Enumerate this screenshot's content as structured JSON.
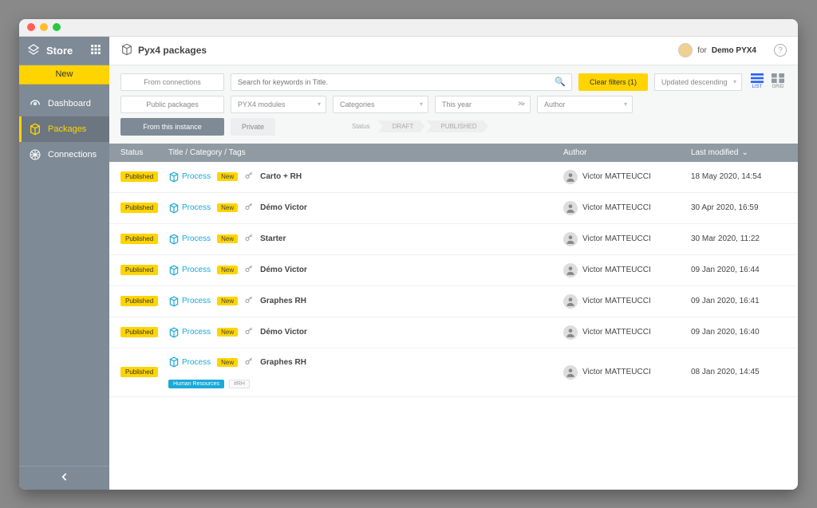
{
  "sidebar": {
    "title": "Store",
    "new_label": "New",
    "items": [
      {
        "label": "Dashboard"
      },
      {
        "label": "Packages"
      },
      {
        "label": "Connections"
      }
    ],
    "active_index": 1
  },
  "header": {
    "page_title": "Pyx4 packages",
    "for_label": "for",
    "org_name": "Demo PYX4"
  },
  "filters": {
    "source_tabs": {
      "from_connections": "From connections",
      "public_packages": "Public packages",
      "from_this_instance": "From this instance"
    },
    "search_placeholder": "Search for keywords in Title.",
    "clear_label": "Clear filters (1)",
    "sort_label": "Updated descending",
    "module_label": "PYX4 modules",
    "categories_label": "Categories",
    "period_label": "This year",
    "author_label": "Author",
    "private_label": "Private",
    "status_label": "Status",
    "status_draft": "DRAFT",
    "status_published": "PUBLISHED",
    "view_list": "LIST",
    "view_grid": "GRID"
  },
  "table": {
    "headers": {
      "status": "Status",
      "title": "Title / Category / Tags",
      "author": "Author",
      "modified": "Last modified"
    },
    "process_label": "Process",
    "new_chip": "New",
    "published_badge": "Published",
    "rows": [
      {
        "title": "Carto + RH",
        "author": "Victor MATTEUCCI",
        "date": "18 May 2020, 14:54",
        "tags": []
      },
      {
        "title": "Démo Victor",
        "author": "Victor MATTEUCCI",
        "date": "30 Apr 2020, 16:59",
        "tags": []
      },
      {
        "title": "Starter",
        "author": "Victor MATTEUCCI",
        "date": "30 Mar 2020, 11:22",
        "tags": []
      },
      {
        "title": "Démo Victor",
        "author": "Victor MATTEUCCI",
        "date": "09 Jan 2020, 16:44",
        "tags": []
      },
      {
        "title": "Graphes RH",
        "author": "Victor MATTEUCCI",
        "date": "09 Jan 2020, 16:41",
        "tags": []
      },
      {
        "title": "Démo Victor",
        "author": "Victor MATTEUCCI",
        "date": "09 Jan 2020, 16:40",
        "tags": []
      },
      {
        "title": "Graphes RH",
        "author": "Victor MATTEUCCI",
        "date": "08 Jan 2020, 14:45",
        "tags": [
          {
            "kind": "blue",
            "text": "Human Resources"
          },
          {
            "kind": "grey",
            "text": "#RH"
          }
        ]
      }
    ]
  }
}
